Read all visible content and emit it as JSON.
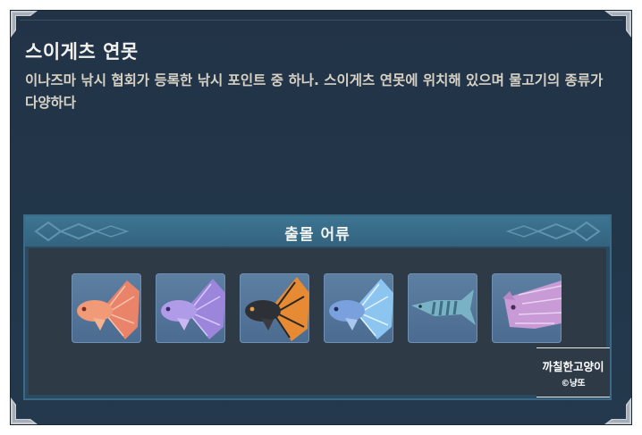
{
  "location": {
    "title": "스이게츠 연못",
    "description": "이나즈마 낚시 협회가 등록한 낚시 포인트 중 하나. 스이게츠 연못에 위치해 있으며 물고기의 종류가 다양하다"
  },
  "fish_section": {
    "label": "출몰 어류",
    "fish": [
      {
        "icon": "pink-coral-betta-fish-icon",
        "color": "#f08a6c"
      },
      {
        "icon": "purple-betta-fish-icon",
        "color": "#a48be0"
      },
      {
        "icon": "dark-orange-betta-fish-icon",
        "color": "#e8923a"
      },
      {
        "icon": "blue-betta-fish-icon",
        "color": "#8fc7f2"
      },
      {
        "icon": "striped-pike-fish-icon",
        "color": "#7bb2c6"
      },
      {
        "icon": "pink-striped-fish-icon",
        "color": "#c99ad6"
      }
    ]
  },
  "credit": {
    "name": "까칠한고양이",
    "copyright": "©냥또"
  },
  "colors": {
    "panel": "#22364a",
    "header": "#3d7593",
    "icon_slot": "#5d7fa2"
  }
}
